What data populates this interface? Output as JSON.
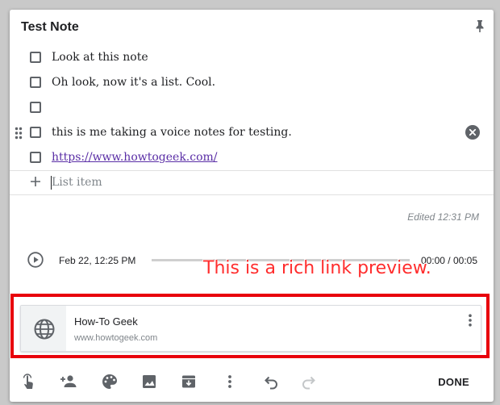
{
  "note": {
    "title": "Test Note",
    "items": [
      {
        "text": "Look at this note",
        "checked": false
      },
      {
        "text": "Oh look, now it's a list. Cool.",
        "checked": false
      },
      {
        "text": "",
        "checked": false
      },
      {
        "text": "this is me taking a voice notes for testing.",
        "checked": false
      },
      {
        "text": "https://www.howtogeek.com/",
        "checked": false,
        "link": true
      }
    ],
    "add_placeholder": "List item",
    "edited": "Edited 12:31 PM"
  },
  "audio": {
    "date": "Feb 22, 12:25 PM",
    "time": "00:00 / 00:05"
  },
  "annotation": {
    "text": "This is a rich link preview.",
    "color": "#ff2d2d"
  },
  "preview": {
    "title": "How-To Geek",
    "domain": "www.howtogeek.com"
  },
  "toolbar": {
    "done_label": "DONE",
    "icons": [
      "touch-gesture-icon",
      "add-collaborator-icon",
      "palette-icon",
      "image-icon",
      "archive-icon",
      "more-vert-icon",
      "undo-icon",
      "redo-icon"
    ]
  },
  "colors": {
    "highlight": "#e8000b",
    "link": "#5a2ea6",
    "muted": "#80868b"
  }
}
